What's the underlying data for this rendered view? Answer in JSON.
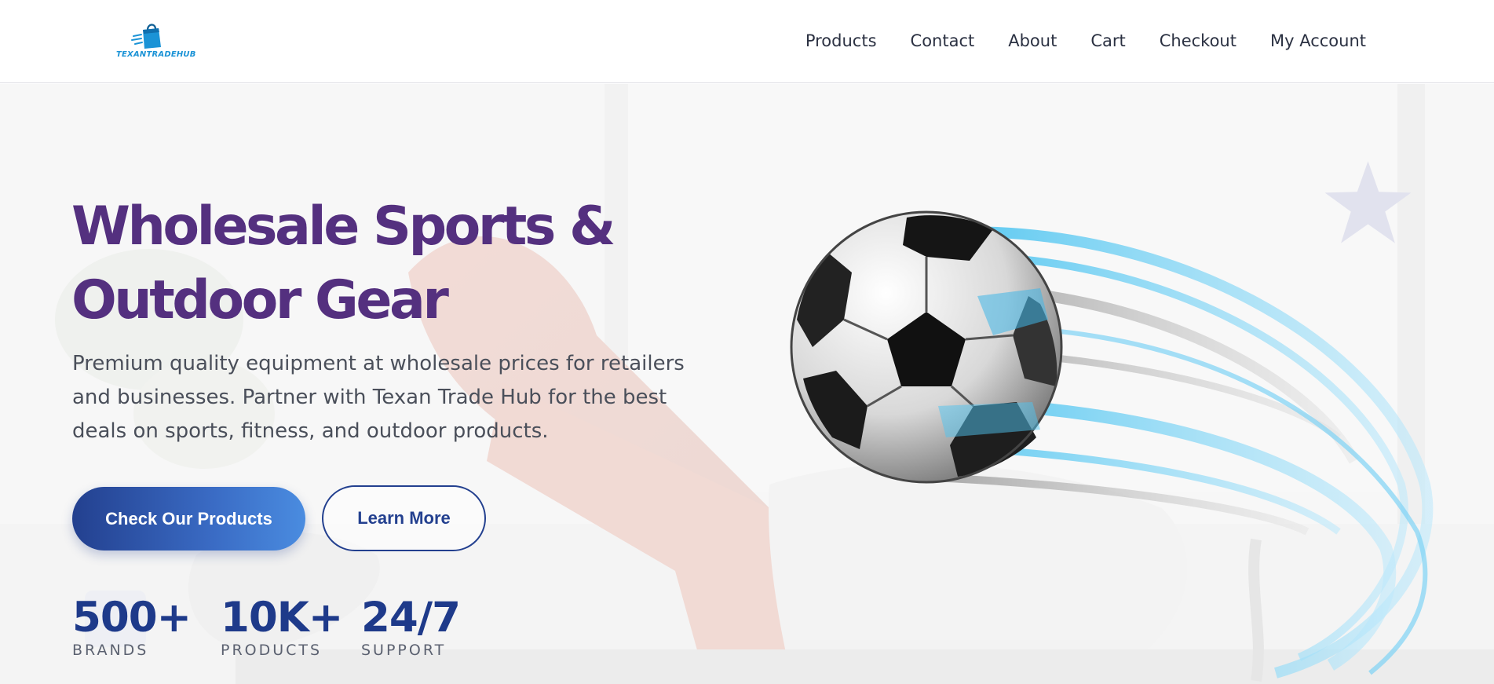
{
  "brand": {
    "logo_text": "TEXANTRADEHUB",
    "color": "#1b93d6"
  },
  "nav": {
    "items": [
      "Products",
      "Contact",
      "About",
      "Cart",
      "Checkout",
      "My Account"
    ]
  },
  "hero": {
    "title_line1": "Wholesale Sports &",
    "title_line2": "Outdoor Gear",
    "description": "Premium quality equipment at wholesale prices for retailers and businesses. Partner with Texan Trade Hub for the best deals on sports, fitness, and outdoor products.",
    "primary_button": "Check Our Products",
    "secondary_button": "Learn More",
    "stats": [
      {
        "value": "500+",
        "label": "BRANDS"
      },
      {
        "value": "10K+",
        "label": "PRODUCTS"
      },
      {
        "value": "24/7",
        "label": "SUPPORT"
      }
    ]
  },
  "colors": {
    "title": "#54307f",
    "accent": "#23408f",
    "stat": "#1e3a8a"
  },
  "icons": [
    "shopping-bag-icon",
    "soccer-ball-illustration",
    "star-icon"
  ]
}
